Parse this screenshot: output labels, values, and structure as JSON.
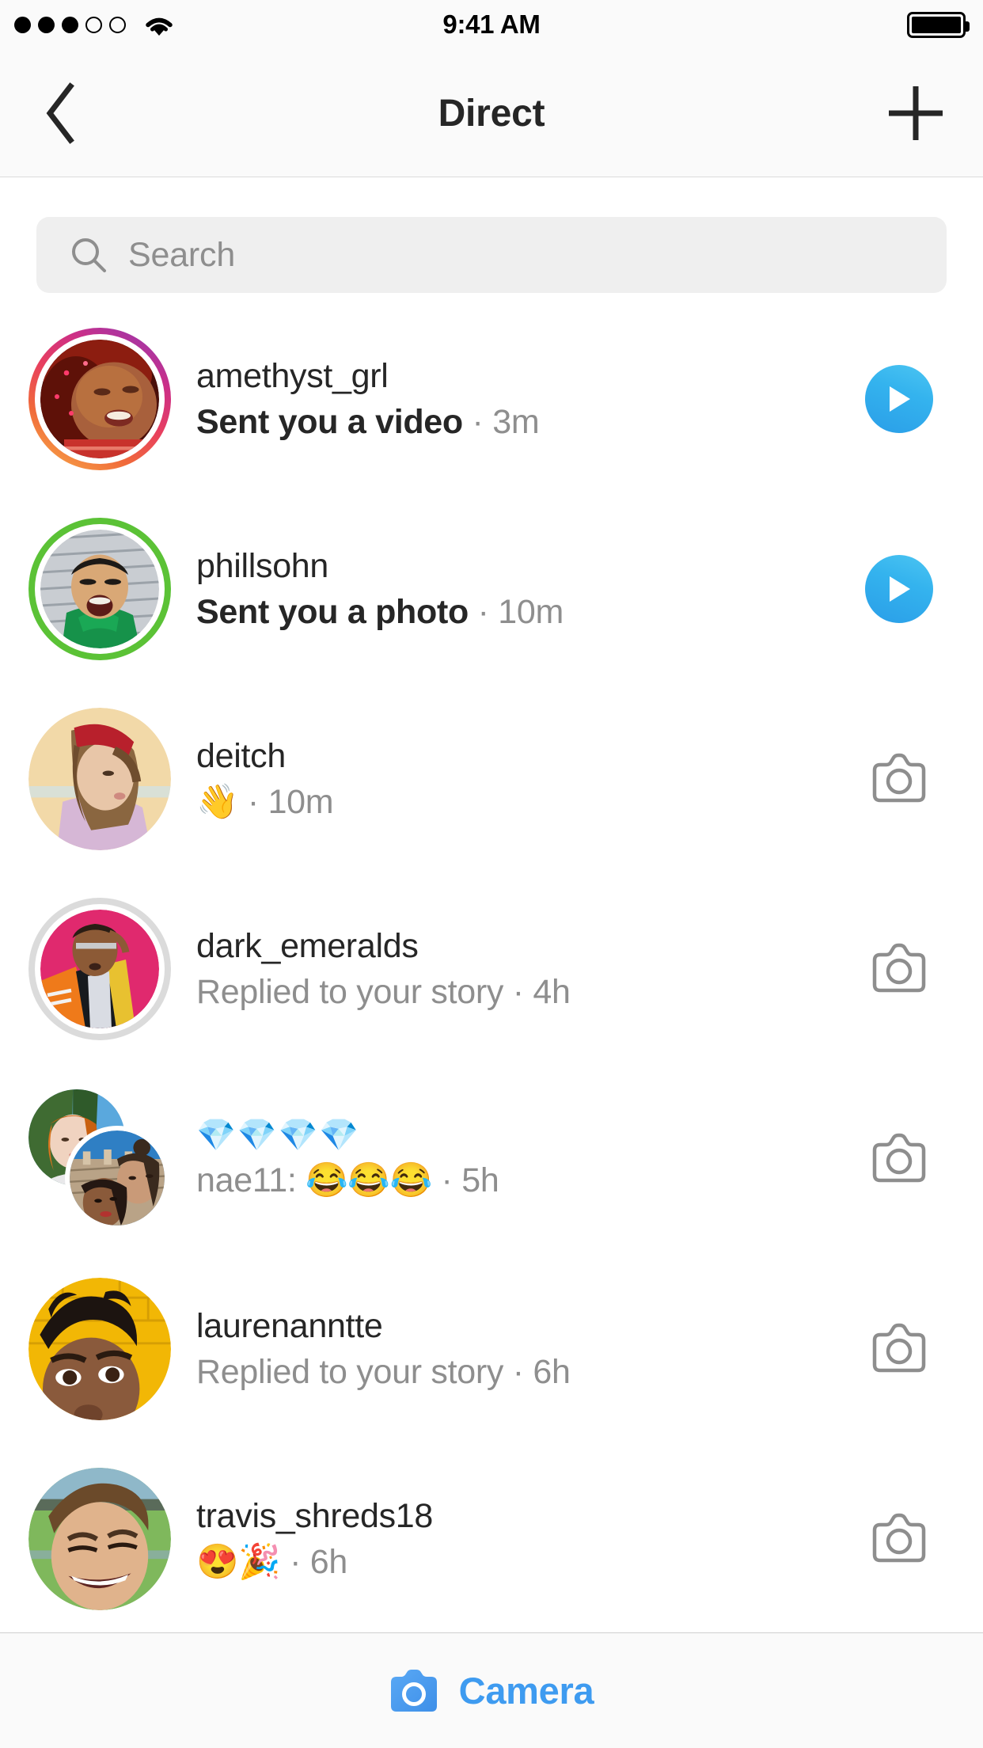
{
  "status_bar": {
    "signal_icon": "signal-dots-icon",
    "signal_filled": 3,
    "signal_total": 5,
    "wifi_icon": "wifi-icon",
    "time": "9:41 AM",
    "battery_icon": "battery-full-icon",
    "battery_level": 100
  },
  "nav": {
    "back_icon": "chevron-left-icon",
    "title": "Direct",
    "new_message_icon": "plus-icon"
  },
  "search": {
    "icon": "search-icon",
    "value": "",
    "placeholder": "Search"
  },
  "threads": [
    {
      "title": "amethyst_grl",
      "message": "Sent you a video",
      "time": " · 3m",
      "unread": true,
      "ring": "gradient",
      "action_icon": "play-icon",
      "avatar_type": "single"
    },
    {
      "title": "phillsohn",
      "message": "Sent you a photo",
      "time": " · 10m",
      "unread": true,
      "ring": "green",
      "action_icon": "play-icon",
      "avatar_type": "single"
    },
    {
      "title": "deitch",
      "message": "👋",
      "time": " · 10m",
      "unread": false,
      "ring": "none",
      "action_icon": "camera-icon",
      "avatar_type": "single"
    },
    {
      "title": "dark_emeralds",
      "message": "Replied to your story",
      "time": " · 4h",
      "unread": false,
      "ring": "gray",
      "action_icon": "camera-icon",
      "avatar_type": "single"
    },
    {
      "title": "💎💎💎💎",
      "message": "nae11: 😂😂😂",
      "time": " · 5h",
      "unread": false,
      "ring": "none",
      "action_icon": "camera-icon",
      "avatar_type": "group"
    },
    {
      "title": "laurenanntte",
      "message": "Replied to your story",
      "time": " · 6h",
      "unread": false,
      "ring": "none",
      "action_icon": "camera-icon",
      "avatar_type": "single"
    },
    {
      "title": "travis_shreds18",
      "message": "😍🎉",
      "time": " · 6h",
      "unread": false,
      "ring": "none",
      "action_icon": "camera-icon",
      "avatar_type": "single"
    }
  ],
  "bottom_bar": {
    "camera_icon": "camera-filled-icon",
    "camera_label": "Camera"
  },
  "colors": {
    "accent_blue": "#3e9bf0",
    "play_blue": "#34b3ee",
    "close_friends_green": "#5bc236",
    "search_bg": "#efefef",
    "secondary_text": "#8e8e8e",
    "primary_text": "#262626",
    "chrome_bg": "#fafafa"
  }
}
